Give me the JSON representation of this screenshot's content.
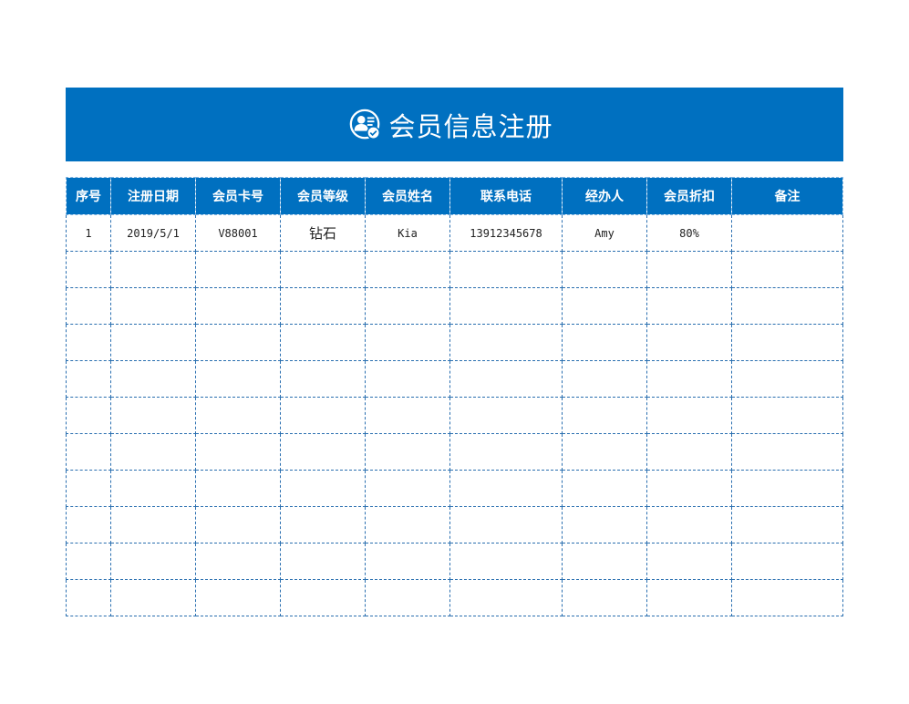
{
  "banner": {
    "icon": "member-badge-check-icon",
    "title": "会员信息注册"
  },
  "table": {
    "columns": [
      "序号",
      "注册日期",
      "会员卡号",
      "会员等级",
      "会员姓名",
      "联系电话",
      "经办人",
      "会员折扣",
      "备注"
    ],
    "rows": [
      [
        "1",
        "2019/5/1",
        "V88001",
        "钻石",
        "Kia",
        "13912345678",
        "Amy",
        "80%",
        ""
      ],
      [
        "",
        "",
        "",
        "",
        "",
        "",
        "",
        "",
        ""
      ],
      [
        "",
        "",
        "",
        "",
        "",
        "",
        "",
        "",
        ""
      ],
      [
        "",
        "",
        "",
        "",
        "",
        "",
        "",
        "",
        ""
      ],
      [
        "",
        "",
        "",
        "",
        "",
        "",
        "",
        "",
        ""
      ],
      [
        "",
        "",
        "",
        "",
        "",
        "",
        "",
        "",
        ""
      ],
      [
        "",
        "",
        "",
        "",
        "",
        "",
        "",
        "",
        ""
      ],
      [
        "",
        "",
        "",
        "",
        "",
        "",
        "",
        "",
        ""
      ],
      [
        "",
        "",
        "",
        "",
        "",
        "",
        "",
        "",
        ""
      ],
      [
        "",
        "",
        "",
        "",
        "",
        "",
        "",
        "",
        ""
      ],
      [
        "",
        "",
        "",
        "",
        "",
        "",
        "",
        "",
        ""
      ]
    ]
  },
  "colors": {
    "accent": "#0070C0",
    "grid_line": "#2a6fb0"
  }
}
